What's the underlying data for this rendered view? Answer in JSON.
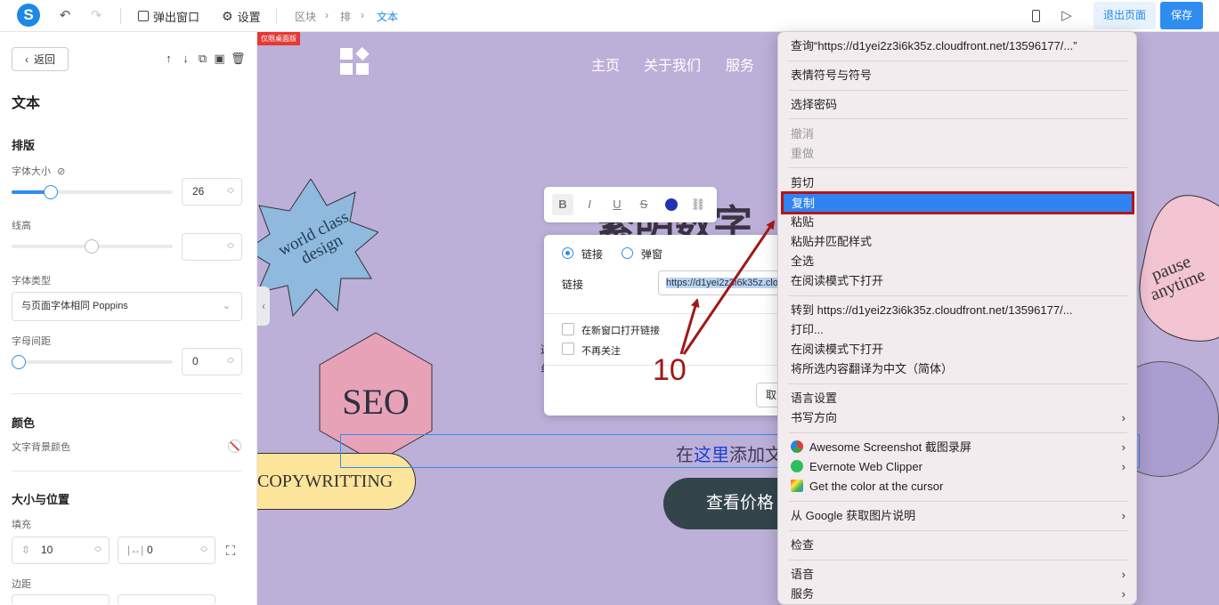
{
  "topbar": {
    "popup_label": "弹出窗口",
    "settings_label": "设置",
    "breadcrumb": [
      "区块",
      "排",
      "文本"
    ],
    "exit_label": "退出页面",
    "save_label": "保存"
  },
  "left_panel": {
    "back_label": "返回",
    "title": "文本",
    "typography_heading": "排版",
    "font_size_label": "字体大小",
    "font_size_value": "26",
    "font_size_fraction": 0.22,
    "line_height_label": "线高",
    "line_height_value": "",
    "font_type_label": "字体类型",
    "font_type_value": "与页面字体相同 Poppins",
    "letter_spacing_label": "字母间距",
    "letter_spacing_value": "0",
    "color_heading": "颜色",
    "bg_color_label": "文字背景颜色",
    "size_position_heading": "大小与位置",
    "padding_label": "填充",
    "padding_vertical": "10",
    "padding_horizontal": "0",
    "margin_label": "边距"
  },
  "canvas": {
    "desktop_tag": "仅限桌面版",
    "nav": [
      "主页",
      "关于我们",
      "服务"
    ],
    "star_text": "world class design",
    "hex_text": "SEO",
    "pill_text": "COPYWRITTING",
    "blob_text": "pause anytime",
    "heading_partial": "繁明数字",
    "add_text_prefix": "在",
    "add_text_link": "这里",
    "add_text_suffix": "添加文",
    "price_button": "查看价格",
    "side_text_1": "这",
    "side_text_2": "单"
  },
  "format_toolbar": {
    "bold": "B",
    "italic": "I",
    "underline": "U",
    "strike": "S",
    "text_color": "#2133b0"
  },
  "link_popup": {
    "option_link": "链接",
    "option_popup": "弹窗",
    "link_label": "链接",
    "url_value": "https://d1yei2z3i6k35z.cloudfront.net",
    "open_new_window": "在新窗口打开链接",
    "nofollow": "不再关注",
    "cancel_label": "取消"
  },
  "annotation": {
    "number": "10",
    "color": "#a01818"
  },
  "context_menu": {
    "lookup": "查询“https://d1yei2z3i6k35z.cloudfront.net/13596177/...”",
    "emoji": "表情符号与符号",
    "choose_password": "选择密码",
    "undo": "撤消",
    "redo": "重做",
    "cut": "剪切",
    "copy": "复制",
    "paste": "粘贴",
    "paste_match": "粘贴并匹配样式",
    "select_all": "全选",
    "reader_mode_1": "在阅读模式下打开",
    "goto": "转到 https://d1yei2z3i6k35z.cloudfront.net/13596177/...",
    "print": "打印...",
    "reader_mode_2": "在阅读模式下打开",
    "translate": "将所选内容翻译为中文（简体）",
    "language_settings": "语言设置",
    "writing_direction": "书写方向",
    "awesome_screenshot": "Awesome Screenshot 截图录屏",
    "evernote": "Evernote Web Clipper",
    "color_cursor": "Get the color at the cursor",
    "google_image": "从 Google 获取图片说明",
    "inspect": "检查",
    "speech": "语音",
    "services": "服务",
    "highlight_color": "#2f83f2",
    "highlight_border": "#b5141c"
  }
}
